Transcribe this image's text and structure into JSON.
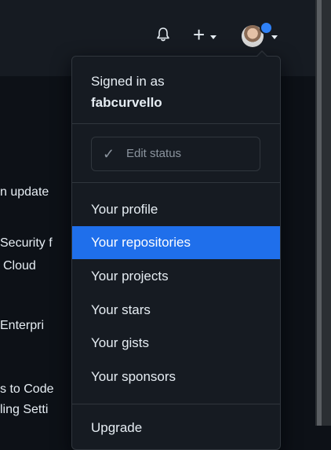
{
  "background_text": {
    "line1": "n update",
    "line2": "Security f",
    "line3": "Cloud",
    "line4": "Enterpri",
    "line5": "s to Code",
    "line6": "ling Setti"
  },
  "header": {
    "bell_icon": "bell-icon",
    "plus_label": "+",
    "avatar_status_color": "#2f81f7"
  },
  "menu": {
    "signed_in_label": "Signed in as",
    "username": "fabcurvello",
    "edit_status_label": "Edit status",
    "items": [
      {
        "label": "Your profile"
      },
      {
        "label": "Your repositories",
        "active": true
      },
      {
        "label": "Your projects"
      },
      {
        "label": "Your stars"
      },
      {
        "label": "Your gists"
      },
      {
        "label": "Your sponsors"
      },
      {
        "label": "Upgrade"
      }
    ]
  },
  "colors": {
    "accent": "#1f6feb",
    "page_bg": "#0d1117",
    "menu_bg": "#161b22"
  }
}
